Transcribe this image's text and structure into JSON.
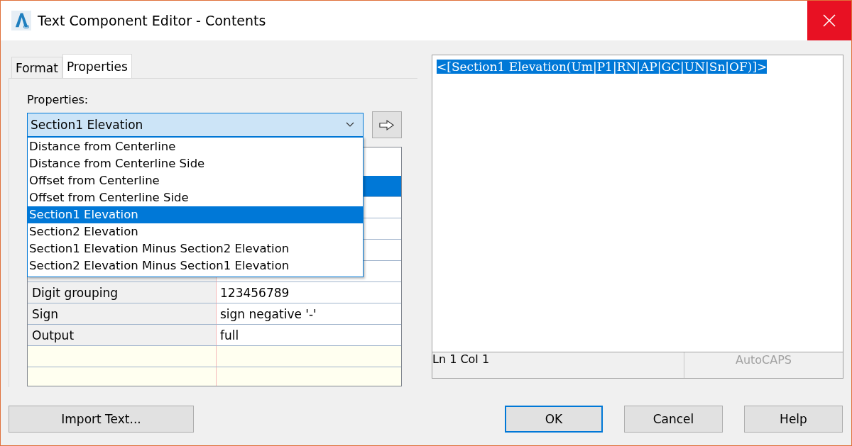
{
  "window": {
    "title": "Text Component Editor - Contents"
  },
  "tabs": [
    {
      "label": "Format",
      "selected": false
    },
    {
      "label": "Properties",
      "selected": true
    }
  ],
  "properties_label": "Properties:",
  "property_combo": {
    "value": "Section1 Elevation",
    "expanded": true
  },
  "dropdown_items": [
    {
      "label": "Distance from Centerline",
      "selected": false
    },
    {
      "label": "Distance from Centerline Side",
      "selected": false
    },
    {
      "label": "Offset from Centerline",
      "selected": false
    },
    {
      "label": "Offset from Centerline Side",
      "selected": false
    },
    {
      "label": "Section1 Elevation",
      "selected": true
    },
    {
      "label": "Section2 Elevation",
      "selected": false
    },
    {
      "label": "Section1 Elevation Minus Section2 Elevation",
      "selected": false
    },
    {
      "label": "Section2 Elevation Minus Section1 Elevation",
      "selected": false
    }
  ],
  "grid": {
    "selection_bar": true
  },
  "grid_rows": [
    {
      "kind": "row",
      "label": "Digit grouping",
      "value": "123456789"
    },
    {
      "kind": "row",
      "label": "Sign",
      "value": "sign negative '-'"
    },
    {
      "kind": "row",
      "label": "Output",
      "value": "full"
    },
    {
      "kind": "empty"
    },
    {
      "kind": "empty"
    }
  ],
  "editor": {
    "text": "<[Section1 Elevation(Um|P1|RN|AP|GC|UN|Sn|OF)]>",
    "text_selected": true
  },
  "status_bar": {
    "position": "Ln 1 Col 1",
    "mode": "AutoCAPS"
  },
  "buttons": [
    {
      "label": "Import Text...",
      "default": false
    },
    {
      "label": "OK",
      "default": true
    },
    {
      "label": "Cancel",
      "default": false
    },
    {
      "label": "Help",
      "default": false
    }
  ]
}
